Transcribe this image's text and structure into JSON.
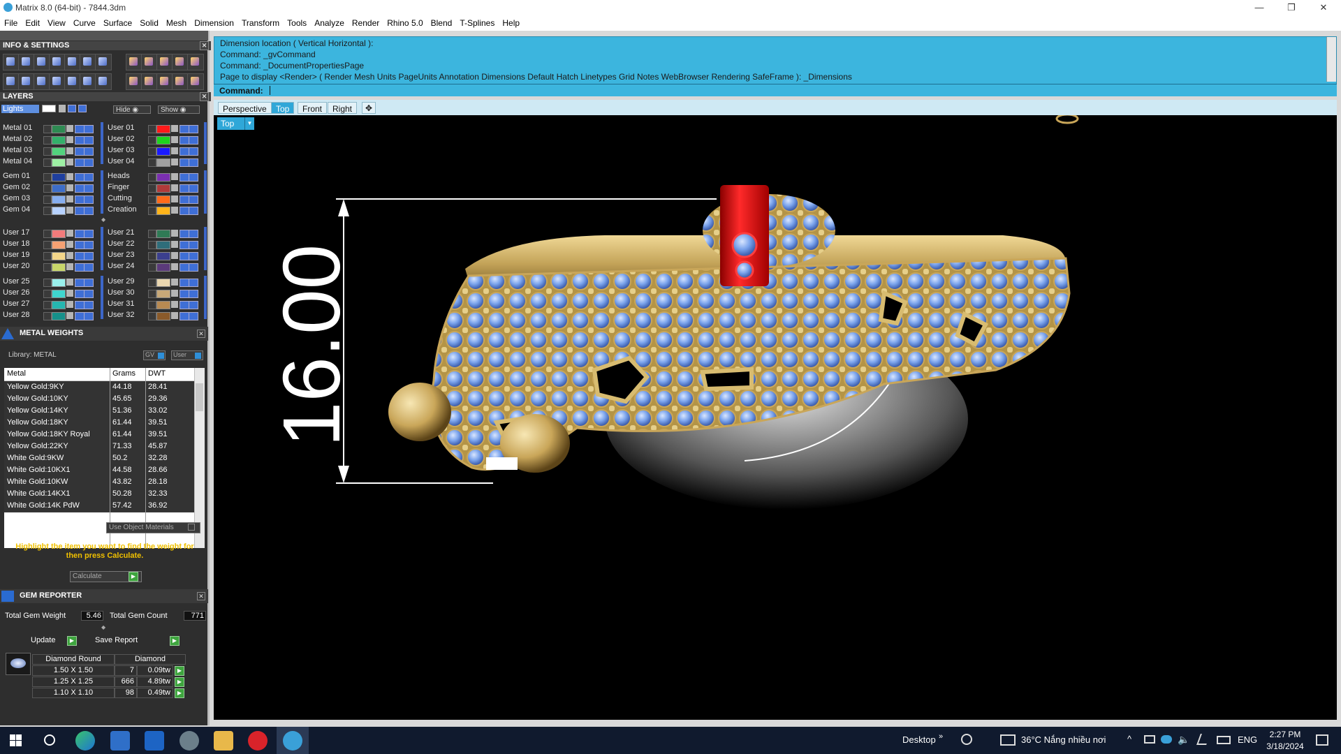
{
  "window": {
    "title": "Matrix 8.0 (64-bit) - 7844.3dm",
    "min_glyph": "—",
    "max_glyph": "❐",
    "close_glyph": "✕"
  },
  "menu": [
    "File",
    "Edit",
    "View",
    "Curve",
    "Surface",
    "Solid",
    "Mesh",
    "Dimension",
    "Transform",
    "Tools",
    "Analyze",
    "Render",
    "Rhino 5.0",
    "Blend",
    "T-Splines",
    "Help"
  ],
  "info_settings": {
    "title": "INFO & SETTINGS",
    "close_glyph": "✕"
  },
  "layers": {
    "title": "LAYERS",
    "close_glyph": "✕",
    "current": "Lights",
    "hide_label": "Hide",
    "show_label": "Show",
    "left_col": [
      {
        "name": "Metal 01",
        "color": "#2e8a52"
      },
      {
        "name": "Metal 02",
        "color": "#33b06a"
      },
      {
        "name": "Metal 03",
        "color": "#52d27d"
      },
      {
        "name": "Metal 04",
        "color": "#9ef0a4"
      },
      {
        "name": "Gem 01",
        "color": "#1f3f9e"
      },
      {
        "name": "Gem 02",
        "color": "#3d6dc9"
      },
      {
        "name": "Gem 03",
        "color": "#86aef0"
      },
      {
        "name": "Gem 04",
        "color": "#b7d2ff"
      },
      {
        "name": "User 17",
        "color": "#f37b7b"
      },
      {
        "name": "User 18",
        "color": "#f5a173"
      },
      {
        "name": "User 19",
        "color": "#f4d68a"
      },
      {
        "name": "User 20",
        "color": "#c8d66a"
      },
      {
        "name": "User 25",
        "color": "#9af0ec"
      },
      {
        "name": "User 26",
        "color": "#3fd6cf"
      },
      {
        "name": "User 27",
        "color": "#26b6b0"
      },
      {
        "name": "User 28",
        "color": "#16908a"
      }
    ],
    "right_col": [
      {
        "name": "User 01",
        "color": "#ff1a1a"
      },
      {
        "name": "User 02",
        "color": "#1ed41e"
      },
      {
        "name": "User 03",
        "color": "#1a1aff"
      },
      {
        "name": "User 04",
        "color": "#a0a0a0"
      },
      {
        "name": "Heads",
        "color": "#7a2fb0"
      },
      {
        "name": "Finger",
        "color": "#b03a3a"
      },
      {
        "name": "Cutting",
        "color": "#ff6a1a"
      },
      {
        "name": "Creation",
        "color": "#ffb41a"
      },
      {
        "name": "User 21",
        "color": "#2f7a55"
      },
      {
        "name": "User 22",
        "color": "#2f6d7a"
      },
      {
        "name": "User 23",
        "color": "#3b3f8e"
      },
      {
        "name": "User 24",
        "color": "#5b3a7a"
      },
      {
        "name": "User 29",
        "color": "#e9d6b0"
      },
      {
        "name": "User 30",
        "color": "#c8a878"
      },
      {
        "name": "User 31",
        "color": "#b88a52"
      },
      {
        "name": "User 32",
        "color": "#8a5a2a"
      }
    ]
  },
  "metal_weights": {
    "title": "METAL WEIGHTS",
    "close_glyph": "✕",
    "library": "Library: METAL",
    "gv_label": "GV",
    "user_label": "User",
    "columns": [
      "Metal",
      "Grams",
      "DWT"
    ],
    "rows": [
      [
        "Yellow Gold:9KY",
        "44.18",
        "28.41"
      ],
      [
        "Yellow Gold:10KY",
        "45.65",
        "29.36"
      ],
      [
        "Yellow Gold:14KY",
        "51.36",
        "33.02"
      ],
      [
        "Yellow Gold:18KY",
        "61.44",
        "39.51"
      ],
      [
        "Yellow Gold:18KY Royal",
        "61.44",
        "39.51"
      ],
      [
        "Yellow Gold:22KY",
        "71.33",
        "45.87"
      ],
      [
        "White Gold:9KW",
        "50.2",
        "32.28"
      ],
      [
        "White Gold:10KX1",
        "44.58",
        "28.66"
      ],
      [
        "White Gold:10KW",
        "43.82",
        "28.18"
      ],
      [
        "White Gold:14KX1",
        "50.28",
        "32.33"
      ],
      [
        "White Gold:14K PdW",
        "57.42",
        "36.92"
      ]
    ],
    "use_object_materials": "Use Object Materials",
    "hint": "Highlight the item you want to find the weight for then press Calculate.",
    "calculate_label": "Calculate"
  },
  "gem_reporter": {
    "title": "GEM REPORTER",
    "close_glyph": "✕",
    "total_weight_label": "Total Gem Weight",
    "total_weight": "5.46",
    "total_count_label": "Total Gem Count",
    "total_count": "771",
    "update_label": "Update",
    "save_label": "Save Report",
    "col1": "Diamond Round",
    "col2": "Diamond",
    "rows": [
      [
        "1.50 X 1.50",
        "7",
        "0.09tw"
      ],
      [
        "1.25 X 1.25",
        "666",
        "4.89tw"
      ],
      [
        "1.10 X 1.10",
        "98",
        "0.49tw"
      ]
    ]
  },
  "command": {
    "history": [
      "Dimension location ( Vertical  Horizontal ):",
      "Command: _gvCommand",
      "Command: _DocumentPropertiesPage",
      "Page to display <Render> ( Render  Mesh  Units  PageUnits  Annotation  Dimensions  Default  Hatch  Linetypes  Grid  Notes  WebBrowser  Rendering  SafeFrame ): _Dimensions"
    ],
    "prompt": "Command:"
  },
  "viewport": {
    "tabs": [
      "Perspective",
      "Top",
      "Front",
      "Right"
    ],
    "active_tab": "Top",
    "add_tab_glyph": "✥",
    "label": "Top",
    "dimension_text": "16.00",
    "dd_glyph": "▼"
  },
  "taskbar": {
    "desktop_label": "Desktop",
    "weather": "36°C  Nắng nhiều nơi",
    "lang": "ENG",
    "time": "2:27 PM",
    "date": "3/18/2024",
    "chevron": "»",
    "up_glyph": "^"
  },
  "colors": {
    "command_bg": "#3cb5de",
    "viewport_bg": "#000000",
    "gold": "#c8a85c",
    "gem_blue": "#6f9be6",
    "head_red": "#e01818",
    "taskbar_bg": "#101a2e"
  }
}
